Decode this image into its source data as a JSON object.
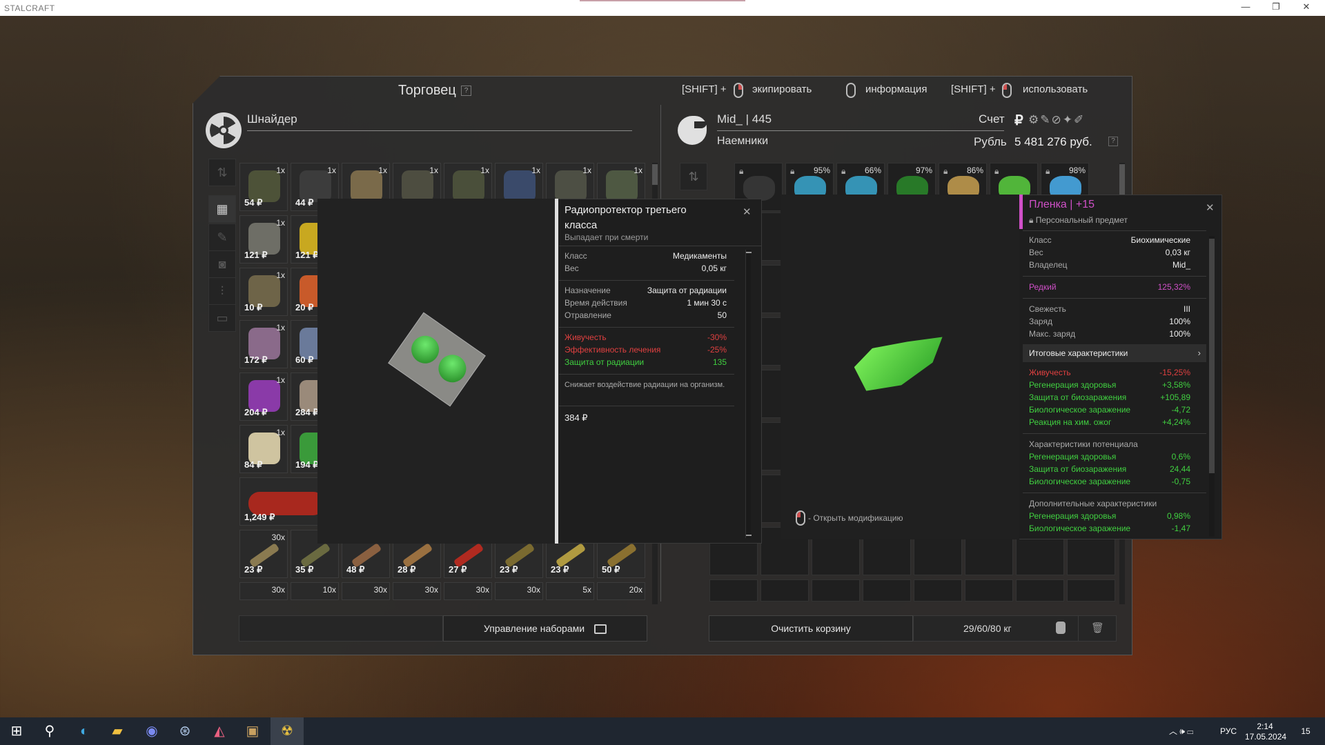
{
  "window": {
    "app_title": "STALCRAFT",
    "controls": [
      "—",
      "❐",
      "✕"
    ]
  },
  "trader": {
    "title": "Торговец",
    "help": "?",
    "hints": [
      {
        "prefix": "[SHIFT] +",
        "label": "экипировать"
      },
      {
        "prefix": "",
        "label": "информация"
      },
      {
        "prefix": "[SHIFT] +",
        "label": "использовать"
      }
    ],
    "merchant_name": "Шнайдер",
    "player": {
      "name": "Mid_ | 445",
      "faction": "Наемники",
      "account_label": "Счет",
      "currency_label": "Рубль",
      "balance": "5 481 276 руб.",
      "balance_help": "?"
    }
  },
  "store_items": [
    {
      "count": "1x",
      "price": "54 ₽",
      "color": "#4d5238"
    },
    {
      "count": "1x",
      "price": "44 ₽",
      "color": "#3c3c3c"
    },
    {
      "count": "1x",
      "price": "",
      "color": "#7a6a4a"
    },
    {
      "count": "1x",
      "price": "",
      "color": "#4d4d40"
    },
    {
      "count": "1x",
      "price": "",
      "color": "#4a4f3a"
    },
    {
      "count": "1x",
      "price": "",
      "color": "#3a4a6a"
    },
    {
      "count": "1x",
      "price": "",
      "color": "#4d4f44"
    },
    {
      "count": "1x",
      "price": "",
      "color": "#4e5842"
    },
    {
      "count": "1x",
      "price": "121 ₽",
      "color": "#6e6e66"
    },
    {
      "count": "",
      "price": "121 ₽",
      "color": "#c8a820"
    },
    {
      "count": "1x",
      "price": "10 ₽",
      "color": "#6e6448"
    },
    {
      "count": "",
      "price": "20 ₽",
      "color": "#c85a2a"
    },
    {
      "count": "1x",
      "price": "172 ₽",
      "color": "#8a6a8a"
    },
    {
      "count": "",
      "price": "60 ₽",
      "color": "#6a7a9a"
    },
    {
      "count": "1x",
      "price": "204 ₽",
      "color": "#8a3aa8"
    },
    {
      "count": "",
      "price": "284 ₽",
      "color": "#9a8a7a"
    },
    {
      "count": "1x",
      "price": "84 ₽",
      "color": "#cfc4a0"
    },
    {
      "count": "",
      "price": "194 ₽",
      "color": "#3a9a3a"
    },
    {
      "count": "",
      "price": "1,249 ₽",
      "color": "#a8281e"
    }
  ],
  "ammo_row": [
    {
      "count": "30x",
      "price": "23 ₽"
    },
    {
      "count": "",
      "price": "35 ₽"
    },
    {
      "count": "",
      "price": "48 ₽"
    },
    {
      "count": "",
      "price": "28 ₽"
    },
    {
      "count": "",
      "price": "27 ₽"
    },
    {
      "count": "",
      "price": "23 ₽"
    },
    {
      "count": "",
      "price": "23 ₽"
    },
    {
      "count": "",
      "price": "50 ₽"
    }
  ],
  "ammo_row2": [
    "30x",
    "10x",
    "30x",
    "30x",
    "30x",
    "30x",
    "5x",
    "20x"
  ],
  "inventory_top": [
    {
      "pct": ""
    },
    {
      "pct": "95%"
    },
    {
      "pct": "66%"
    },
    {
      "pct": "97%"
    },
    {
      "pct": "86%"
    },
    {
      "pct": ""
    },
    {
      "pct": "98%"
    }
  ],
  "item_popup": {
    "title": "Радиопротектор третьего класса",
    "subtitle": "Выпадает при смерти",
    "rows1": [
      {
        "k": "Класс",
        "v": "Медикаменты"
      },
      {
        "k": "Вес",
        "v": "0,05 кг"
      }
    ],
    "rows2": [
      {
        "k": "Назначение",
        "v": "Защита от радиации"
      },
      {
        "k": "Время действия",
        "v": "1 мин 30 с"
      },
      {
        "k": "Отравление",
        "v": "50"
      }
    ],
    "rows3": [
      {
        "k": "Живучесть",
        "v": "-30%",
        "color": "#e04040"
      },
      {
        "k": "Эффективность лечения",
        "v": "-25%",
        "color": "#e04040"
      },
      {
        "k": "Защита от радиации",
        "v": "135",
        "color": "#40d040"
      }
    ],
    "description": "Снижает воздействие радиации на организм.",
    "price": "384 ₽"
  },
  "artifact_popup": {
    "title": "Пленка | +15",
    "subtitle": "Персональный предмет",
    "rows1": [
      {
        "k": "Класс",
        "v": "Биохимические"
      },
      {
        "k": "Вес",
        "v": "0,03 кг"
      },
      {
        "k": "Владелец",
        "v": "Mid_"
      }
    ],
    "rarity": {
      "k": "Редкий",
      "v": "125,32%"
    },
    "rows2": [
      {
        "k": "Свежесть",
        "v": "III"
      },
      {
        "k": "Заряд",
        "v": "100%"
      },
      {
        "k": "Макс. заряд",
        "v": "100%"
      }
    ],
    "summary_header": "Итоговые характеристики",
    "summary": [
      {
        "k": "Живучесть",
        "v": "-15,25%",
        "color": "#e04040"
      },
      {
        "k": "Регенерация здоровья",
        "v": "+3,58%",
        "color": "#40d040"
      },
      {
        "k": "Защита от биозаражения",
        "v": "+105,89",
        "color": "#40d040"
      },
      {
        "k": "Биологическое заражение",
        "v": "-4,72",
        "color": "#40d040"
      },
      {
        "k": "Реакция на хим. ожог",
        "v": "+4,24%",
        "color": "#40d040"
      }
    ],
    "potential_header": "Характеристики потенциала",
    "potential": [
      {
        "k": "Регенерация здоровья",
        "v": "0,6%"
      },
      {
        "k": "Защита от биозаражения",
        "v": "24,44"
      },
      {
        "k": "Биологическое заражение",
        "v": "-0,75"
      }
    ],
    "extra_header": "Дополнительные характеристики",
    "extra": [
      {
        "k": "Регенерация здоровья",
        "v": "0,98%"
      },
      {
        "k": "Биологическое заражение",
        "v": "-1,47"
      }
    ],
    "mod_hint": "- Открыть модификацию"
  },
  "bottom": {
    "manage_sets": "Управление наборами",
    "clear_cart": "Очистить корзину",
    "weight": "29/60/80 кг"
  },
  "taskbar": {
    "lang": "РУС",
    "time": "2:14",
    "date": "17.05.2024",
    "notif": "15"
  },
  "colors": {
    "pink": "#d050c8",
    "green": "#40d040",
    "red": "#e04040"
  }
}
